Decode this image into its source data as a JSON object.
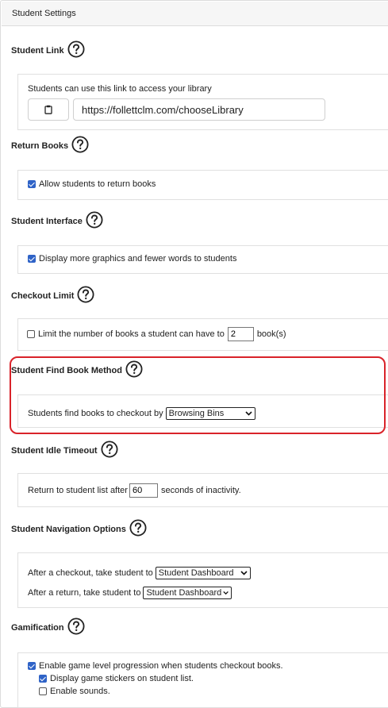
{
  "header": {
    "title": "Student Settings"
  },
  "student_link": {
    "title": "Student Link",
    "description": "Students can use this link to access your library",
    "url": "https://follettclm.com/chooseLibrary"
  },
  "return_books": {
    "title": "Return Books",
    "option_label": "Allow students to return books",
    "checked": true
  },
  "student_interface": {
    "title": "Student Interface",
    "option_label": "Display more graphics and fewer words to students",
    "checked": true
  },
  "checkout_limit": {
    "title": "Checkout Limit",
    "option_label": "Limit the number of books a student can have to",
    "value": "2",
    "suffix": "book(s)",
    "checked": false
  },
  "find_book_method": {
    "title": "Student Find Book Method",
    "label": "Students find books to checkout by",
    "selected": "Browsing Bins"
  },
  "idle_timeout": {
    "title": "Student Idle Timeout",
    "label": "Return to student list after",
    "value": "60",
    "suffix": "seconds of inactivity."
  },
  "navigation_options": {
    "title": "Student Navigation Options",
    "after_checkout_label": "After a checkout, take student to",
    "after_checkout_selected": "Student Dashboard",
    "after_return_label": "After a return, take student to",
    "after_return_selected": "Student Dashboard"
  },
  "gamification": {
    "title": "Gamification",
    "progression_label": "Enable game level progression when students checkout books.",
    "stickers_label": "Display game stickers on student list.",
    "sounds_label": "Enable sounds.",
    "progression_checked": true,
    "stickers_checked": true,
    "sounds_checked": false
  },
  "icons": {
    "help": "help-circle-icon",
    "copy": "clipboard-icon",
    "dropdown": "chevron-down-icon"
  },
  "colors": {
    "checkbox_accent": "#2f63c7",
    "highlight_border": "#d9232a"
  }
}
